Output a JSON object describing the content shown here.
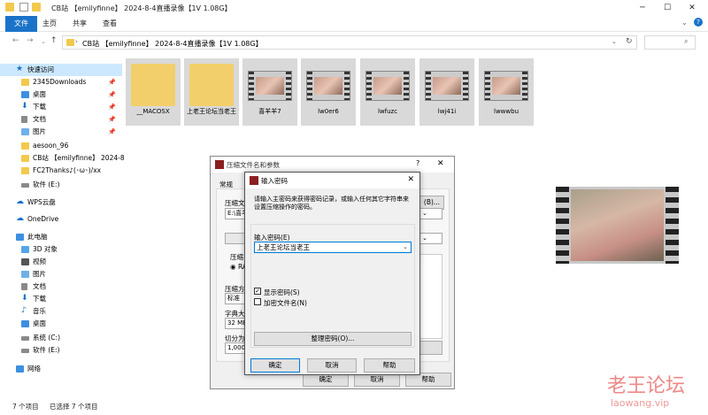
{
  "explorer": {
    "title": "CB站 【emilyfinne】 2024-8-4直播录像【1V 1.08G】",
    "tabs": [
      "文件",
      "主页",
      "共享",
      "查看"
    ],
    "address": "CB站 【emilyfinne】 2024-8-4直播录像【1V 1.08G】",
    "nav": {
      "quick_access": "快速访问",
      "items": [
        {
          "label": "2345Downloads",
          "pinned": true
        },
        {
          "label": "桌面",
          "pinned": true
        },
        {
          "label": "下载",
          "pinned": true
        },
        {
          "label": "文档",
          "pinned": true
        },
        {
          "label": "图片",
          "pinned": true
        },
        {
          "label": "aesoon_96",
          "pinned": false
        },
        {
          "label": "CB站 【emilyfinne】 2024-8",
          "pinned": false
        },
        {
          "label": "FC2Thanks♪(･ω･)/xx",
          "pinned": false
        },
        {
          "label": "软件 (E:)",
          "pinned": false
        }
      ],
      "wps": "WPS云盘",
      "onedrive": "OneDrive",
      "thispc": "此电脑",
      "pc_items": [
        "3D 对象",
        "视频",
        "图片",
        "文档",
        "下载",
        "音乐",
        "桌面",
        "系统 (C:)",
        "软件 (E:)"
      ],
      "network": "网络"
    },
    "files": [
      {
        "name": "__MACOSX",
        "kind": "folder"
      },
      {
        "name": "上老王论坛当老王",
        "kind": "folder"
      },
      {
        "name": "喜羊羊7",
        "kind": "video"
      },
      {
        "name": "lw0er6",
        "kind": "video"
      },
      {
        "name": "lwfuzc",
        "kind": "video"
      },
      {
        "name": "lwj41i",
        "kind": "video"
      },
      {
        "name": "lwwwbu",
        "kind": "video"
      }
    ],
    "status_count": "7 个项目",
    "status_selected": "已选择 7 个项目"
  },
  "archive_dialog": {
    "title": "压缩文件名和参数",
    "help": "?",
    "close": "✕",
    "tab_general": "常规",
    "label_filename": "压缩文",
    "filename_value": "E:\\喜羊",
    "label_format": "压缩",
    "format_value": "RA",
    "label_method": "压缩方",
    "method_value": "标准",
    "label_dict": "字典大",
    "dict_value": "32 MB",
    "label_split": "切分为",
    "split_value": "1,000",
    "browse_btn": "(B)...",
    "ok": "确定",
    "cancel": "取消",
    "help_btn": "帮助"
  },
  "password_dialog": {
    "title": "输入密码",
    "close": "✕",
    "description": "请输入主密码来获得密码记录，或输入任何其它字符串来设置压缩操作的密码。",
    "password_label": "输入密码(E)",
    "password_value": "上老王论坛当老王",
    "show_password": "显示密码(S)",
    "show_password_checked": true,
    "encrypt_names": "加密文件名(N)",
    "encrypt_names_checked": false,
    "organize": "整理密码(O)...",
    "ok": "确定",
    "cancel": "取消",
    "help": "帮助"
  },
  "watermark": {
    "main": "老王论坛",
    "sub": "laowang.vip"
  }
}
